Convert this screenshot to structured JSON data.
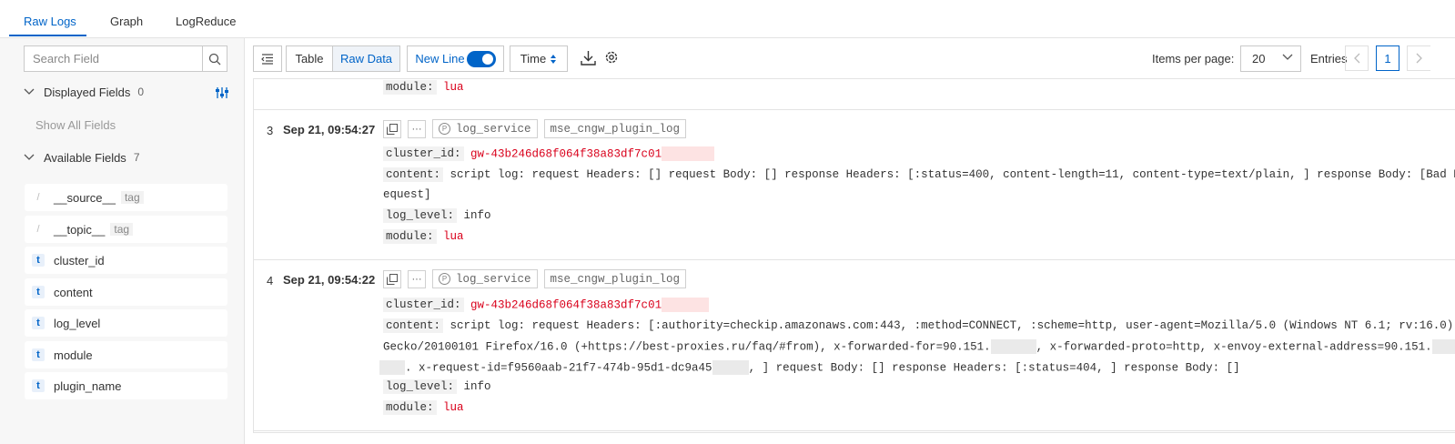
{
  "tabs": [
    {
      "label": "Raw Logs",
      "active": true
    },
    {
      "label": "Graph"
    },
    {
      "label": "LogReduce"
    }
  ],
  "sidebar": {
    "search_placeholder": "Search Field",
    "displayed": {
      "label": "Displayed Fields",
      "count": "0"
    },
    "show_all": "Show All Fields",
    "available": {
      "label": "Available Fields",
      "count": "7"
    },
    "fields": [
      {
        "type": "/",
        "name": "__source__",
        "tag": "tag"
      },
      {
        "type": "/",
        "name": "__topic__",
        "tag": "tag"
      },
      {
        "type": "t",
        "name": "cluster_id"
      },
      {
        "type": "t",
        "name": "content"
      },
      {
        "type": "t",
        "name": "log_level"
      },
      {
        "type": "t",
        "name": "module"
      },
      {
        "type": "t",
        "name": "plugin_name"
      }
    ]
  },
  "toolbar": {
    "table": "Table",
    "raw_data": "Raw Data",
    "new_line": "New Line",
    "time": "Time",
    "items_per_page_label": "Items per page:",
    "items_per_page": "20",
    "entries": "Entries",
    "page": "1"
  },
  "logs": {
    "top_partial": {
      "module_key": "module:",
      "module_val": "lua"
    },
    "entries": [
      {
        "num": "3",
        "time": "Sep 21, 09:54:27",
        "chips": [
          "log_service",
          "mse_cngw_plugin_log"
        ],
        "cluster_key": "cluster_id:",
        "cluster_val": "gw-43b246d68f064f38a83df7c01",
        "content_key": "content:",
        "content_lines": [
          " script log: request Headers: [] request Body: [] response Headers: [:status=400, content-length=11, content-type=text/plain, ] response Body: [Bad R",
          "equest]"
        ],
        "level_key": "log_level:",
        "level_val": "info",
        "module_key": "module:",
        "module_val": "lua"
      },
      {
        "num": "4",
        "time": "Sep 21, 09:54:22",
        "chips": [
          "log_service",
          "mse_cngw_plugin_log"
        ],
        "cluster_key": "cluster_id:",
        "cluster_val": "gw-43b246d68f064f38a83df7c01",
        "content_key": "content:",
        "content_line1": " script log: request Headers: [:authority=checkip.amazonaws.com:443, :method=CONNECT, :scheme=http, user-agent=Mozilla/5.0 (Windows NT 6.1; rv:16.0)",
        "content_line2a": "Gecko/20100101 Firefox/16.0 (+https://best-proxies.ru/faq/#from), x-forwarded-for=90.151.",
        "content_line2b": ", x-forwarded-proto=http, x-envoy-external-address=90.151.",
        "content_line3a": ". x-request-id=f9560aab-21f7-474b-95d1-dc9a45",
        "content_line3b": ", ] request Body: [] response Headers: [:status=404, ] response Body: []",
        "level_key": "log_level:",
        "level_val": "info",
        "module_key": "module:",
        "module_val": "lua"
      }
    ]
  }
}
